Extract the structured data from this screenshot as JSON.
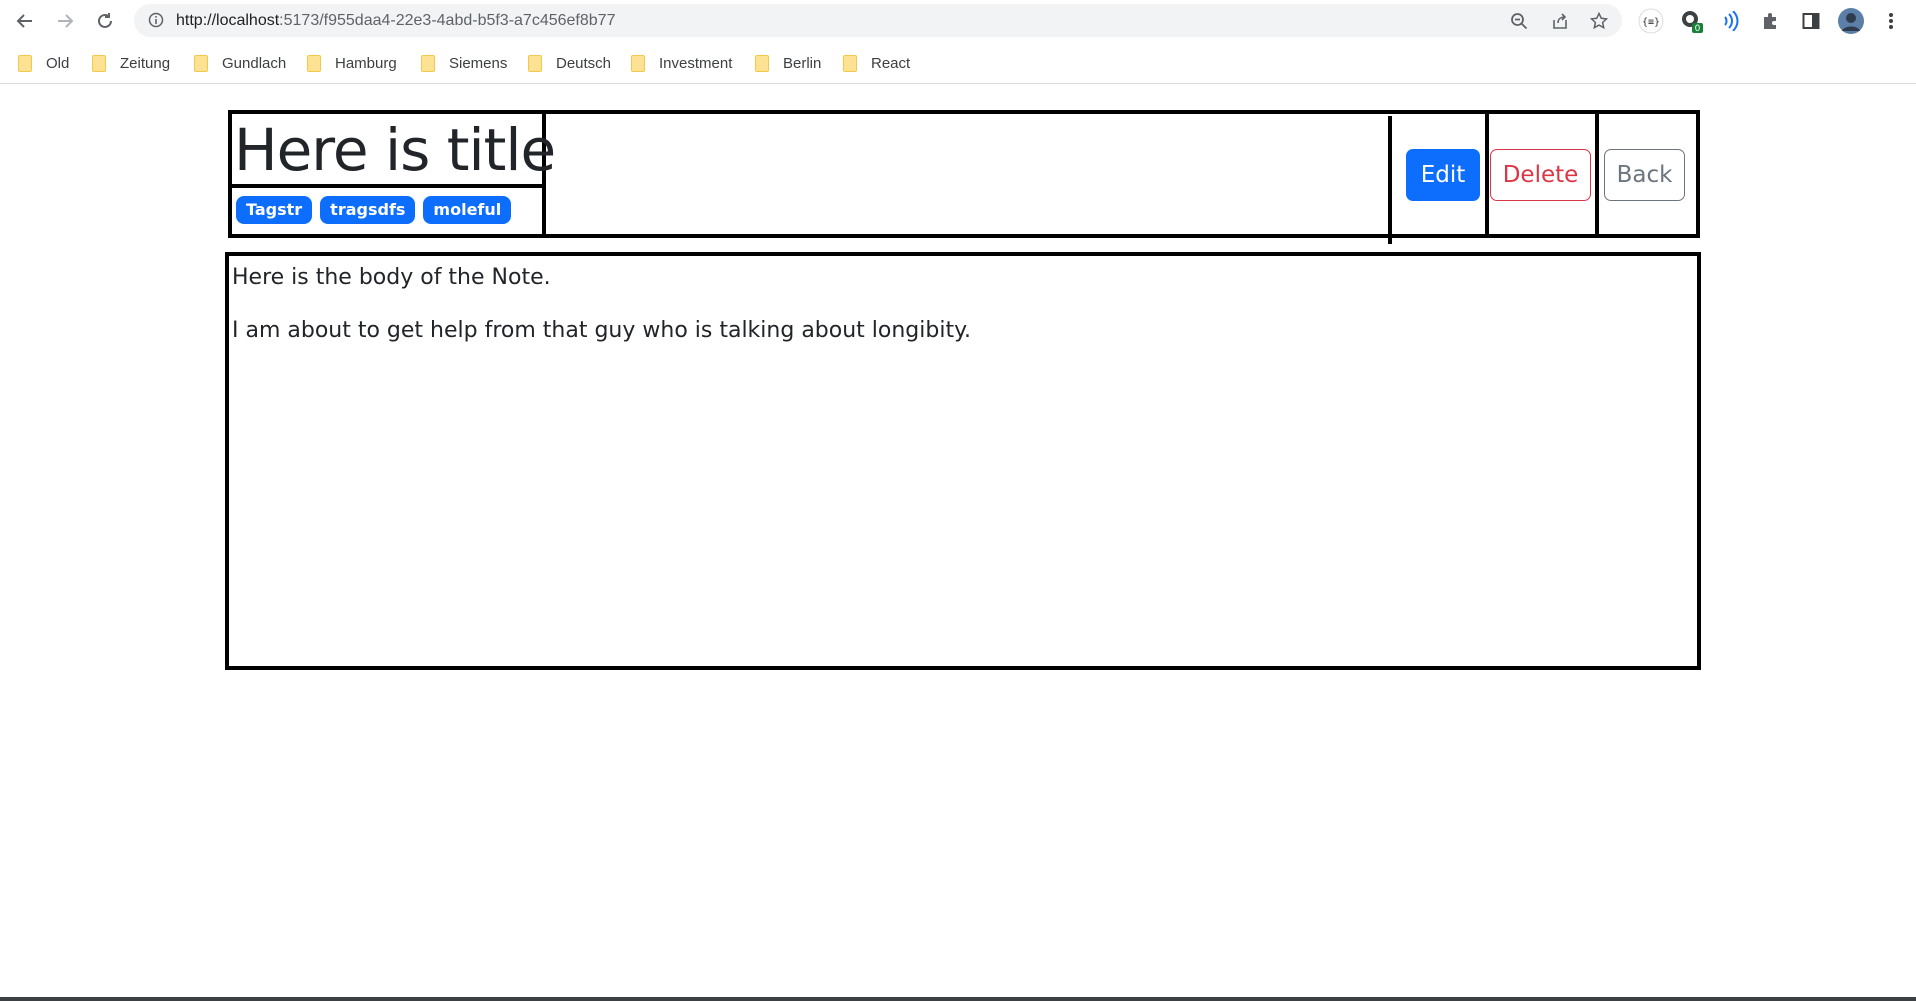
{
  "browser": {
    "url_host": "http://localhost",
    "url_path": ":5173/f955daa4-22e3-4abd-b5f3-a7c456ef8b77",
    "extension_badge": "0",
    "icons": [
      "back-arrow-icon",
      "forward-arrow-icon",
      "reload-icon",
      "site-info-icon",
      "zoom-icon",
      "share-icon",
      "star-icon",
      "puzzle-icon",
      "side-panel-icon",
      "profile-avatar",
      "kebab-menu-icon"
    ],
    "bookmarks": [
      "Old",
      "Zeitung",
      "Gundlach",
      "Hamburg",
      "Siemens",
      "Deutsch",
      "Investment",
      "Berlin",
      "React"
    ]
  },
  "note": {
    "title": "Here is title",
    "tags": [
      "Tagstr",
      "tragsdfs",
      "moleful"
    ],
    "body": [
      "Here is the body of the Note.",
      "I am about to get help from that guy who is talking about longibity."
    ]
  },
  "actions": {
    "edit": "Edit",
    "delete": "Delete",
    "back": "Back"
  },
  "colors": {
    "primary": "#0d6efd",
    "danger": "#dc3545",
    "secondary": "#6c757d",
    "border": "#000000"
  }
}
